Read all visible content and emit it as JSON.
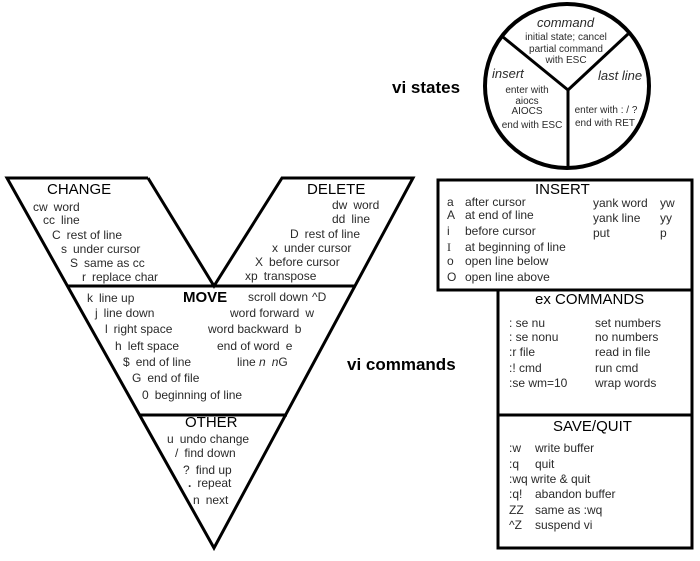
{
  "states": {
    "label": "vi states",
    "command": {
      "title": "command",
      "lines": [
        "initial state; cancel",
        "partial command",
        "with ESC"
      ]
    },
    "insert": {
      "title": "insert",
      "lines": [
        "enter with",
        "aiocs",
        "AIOCS",
        "end with ESC"
      ]
    },
    "last_line": {
      "title": "last line",
      "lines": [
        "enter with : / ?",
        "end with RET"
      ]
    }
  },
  "commands_label": "vi commands",
  "change": {
    "title": "CHANGE",
    "items": [
      {
        "key": "cw",
        "desc": "word"
      },
      {
        "key": "cc",
        "desc": "line"
      },
      {
        "key": "C",
        "desc": "rest of line"
      },
      {
        "key": "s",
        "desc": "under cursor"
      },
      {
        "key": "S",
        "desc": "same as cc"
      },
      {
        "key": "r",
        "desc": "replace char"
      }
    ]
  },
  "delete": {
    "title": "DELETE",
    "items": [
      {
        "key": "dw",
        "desc": "word"
      },
      {
        "key": "dd",
        "desc": "line"
      },
      {
        "key": "D",
        "desc": "rest of line"
      },
      {
        "key": "x",
        "desc": "under cursor"
      },
      {
        "key": "X",
        "desc": "before cursor"
      },
      {
        "key": "xp",
        "desc": "transpose"
      }
    ]
  },
  "move": {
    "title": "MOVE",
    "left_items": [
      {
        "key": "k",
        "desc": "line up"
      },
      {
        "key": "j",
        "desc": "line down"
      },
      {
        "key": "l",
        "desc": "right space"
      },
      {
        "key": "h",
        "desc": "left space"
      },
      {
        "key": "$",
        "desc": "end of line"
      },
      {
        "key": "G",
        "desc": "end of file"
      },
      {
        "key": "0",
        "desc": "beginning of line"
      }
    ],
    "right_items": [
      {
        "desc": "scroll down",
        "key": "^D"
      },
      {
        "desc": "word forward",
        "key": "w"
      },
      {
        "desc": "word backward",
        "key": "b"
      },
      {
        "desc": "end of word",
        "key": "e"
      },
      {
        "desc": "line",
        "arg": "n",
        "key_prefix": "n",
        "key": "G"
      }
    ]
  },
  "other": {
    "title": "OTHER",
    "items": [
      {
        "key": "u",
        "desc": "undo change"
      },
      {
        "key": "/",
        "desc": "find down"
      },
      {
        "key": "?",
        "desc": "find up"
      },
      {
        "key": ".",
        "desc": "repeat"
      },
      {
        "key": "n",
        "desc": "next"
      }
    ]
  },
  "insert": {
    "title": "INSERT",
    "items": [
      {
        "key": "a",
        "desc": "after cursor"
      },
      {
        "key": "A",
        "desc": "at end of line"
      },
      {
        "key": "i",
        "desc": "before cursor"
      },
      {
        "key": "I",
        "desc": "at beginning of line"
      },
      {
        "key": "o",
        "desc": "open line below"
      },
      {
        "key": "O",
        "desc": "open line above"
      }
    ],
    "yank_items": [
      {
        "desc": "yank word",
        "key": "yw"
      },
      {
        "desc": "yank line",
        "key": "yy"
      },
      {
        "desc": "put",
        "key": "p"
      }
    ]
  },
  "ex": {
    "title": "ex COMMANDS",
    "items": [
      {
        "cmd": ": se nu",
        "desc": "set numbers"
      },
      {
        "cmd": ": se nonu",
        "desc": "no numbers"
      },
      {
        "cmd": ":r file",
        "desc": "read in file"
      },
      {
        "cmd": ":! cmd",
        "desc": "run cmd"
      },
      {
        "cmd": ":se wm=10",
        "desc": "wrap words"
      }
    ]
  },
  "save_quit": {
    "title": "SAVE/QUIT",
    "items": [
      {
        "cmd": ":w",
        "desc": "write buffer"
      },
      {
        "cmd": ":q",
        "desc": "quit"
      },
      {
        "cmd": ":wq",
        "desc": "write & quit"
      },
      {
        "cmd": ":q!",
        "desc": "abandon buffer"
      },
      {
        "cmd": "ZZ",
        "desc": "same as :wq"
      },
      {
        "cmd": "^Z",
        "desc": "suspend vi"
      }
    ]
  }
}
